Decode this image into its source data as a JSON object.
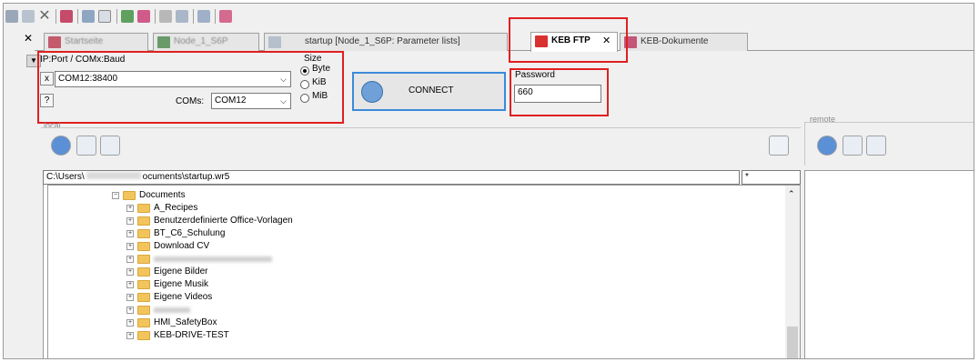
{
  "tabs": [
    {
      "label": "Startseite",
      "icon": "home-icon",
      "blurred": true
    },
    {
      "label": "Node_1_S6P",
      "icon": "node-icon",
      "blurred": true
    },
    {
      "label": "startup [Node_1_S6P: Parameter lists]",
      "icon": "list-icon",
      "blurred": false
    },
    {
      "label": "KEB FTP",
      "icon": "ftp-icon",
      "active": true
    },
    {
      "label": "KEB-Dokumente",
      "icon": "doc-icon"
    }
  ],
  "connection": {
    "port_label": "IP:Port / COMx:Baud",
    "port_value": "COM12:38400",
    "clear_button": "x",
    "help_button": "?",
    "coms_label": "COMs:",
    "coms_value": "COM12",
    "size_label": "Size",
    "size_options": [
      "Byte",
      "KiB",
      "MiB"
    ],
    "size_selected": "Byte",
    "connect_label": "CONNECT",
    "password_label": "Password",
    "password_value": "660"
  },
  "local": {
    "group_label": "local",
    "path": "C:\\Users\\",
    "path_tail": "ocuments\\startup.wr5",
    "filter": "*"
  },
  "remote": {
    "group_label": "remote"
  },
  "tree": {
    "root": "Documents",
    "items": [
      {
        "label": "A_Recipes"
      },
      {
        "label": "Benutzerdefinierte Office-Vorlagen"
      },
      {
        "label": "BT_C6_Schulung"
      },
      {
        "label": "Download CV"
      },
      {
        "label": "",
        "blurred": true
      },
      {
        "label": "Eigene Bilder"
      },
      {
        "label": "Eigene Musik"
      },
      {
        "label": "Eigene Videos"
      },
      {
        "label": "",
        "blurred": true
      },
      {
        "label": "HMI_SafetyBox"
      },
      {
        "label": "KEB-DRIVE-TEST"
      }
    ]
  },
  "colors": {
    "highlight": "#e02020",
    "connect_border": "#3a8ad8",
    "ftp_icon": "#d93030",
    "folder": "#f2c55c"
  }
}
